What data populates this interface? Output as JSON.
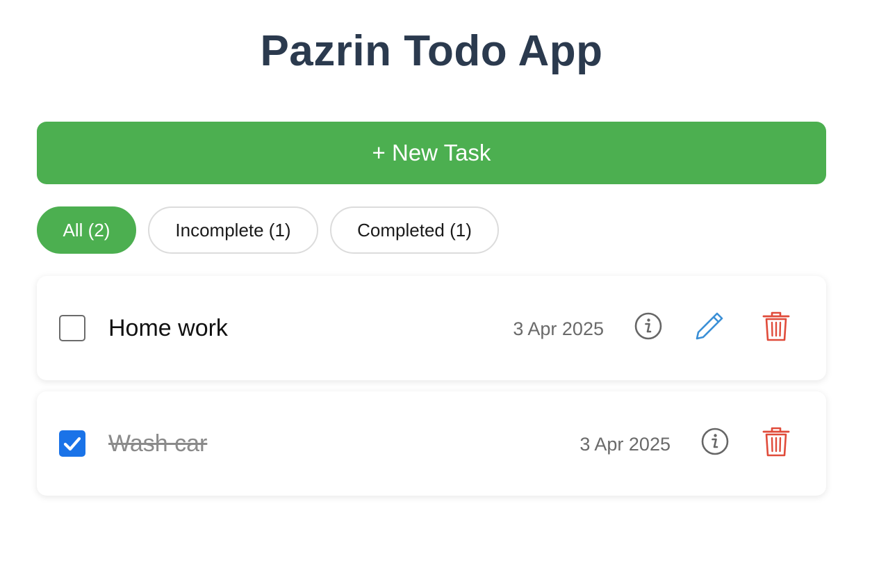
{
  "app": {
    "title": "Pazrin Todo App"
  },
  "toolbar": {
    "new_task_label": "+ New Task"
  },
  "filters": [
    {
      "label": "All (2)",
      "active": true
    },
    {
      "label": "Incomplete (1)",
      "active": false
    },
    {
      "label": "Completed (1)",
      "active": false
    }
  ],
  "tasks": [
    {
      "title": "Home work",
      "date": "3 Apr 2025",
      "completed": false,
      "actions": [
        "info-icon",
        "pencil-icon",
        "trash-icon"
      ]
    },
    {
      "title": "Wash car",
      "date": "3 Apr 2025",
      "completed": true,
      "actions": [
        "info-icon",
        "trash-icon"
      ]
    }
  ],
  "colors": {
    "accent": "#4caf50",
    "title": "#2b3a4e",
    "checkbox_checked": "#1a73e8",
    "edit_icon": "#3a8fd6",
    "delete_icon": "#e04b3a",
    "info_icon": "#666666"
  }
}
